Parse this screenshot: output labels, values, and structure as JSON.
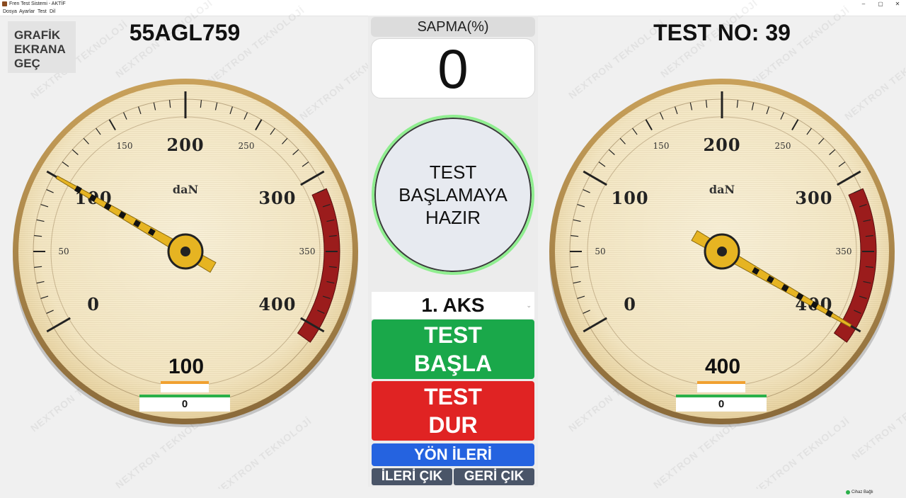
{
  "window": {
    "title": "Fren Test Sistemi - AKTİF",
    "controls": [
      "–",
      "▢",
      "✕"
    ]
  },
  "menu": [
    "Dosya",
    "Ayarlar",
    "Test",
    "Dil"
  ],
  "grafik_button": "GRAFİK\nEKRANA\nGEÇ",
  "plate": "55AGL759",
  "test_no": "TEST NO: 39",
  "sapma": {
    "label": "SAPMA(%)",
    "value": "0"
  },
  "status_text": "TEST\nBAŞLAMAYA\nHAZIR",
  "aks": {
    "selected": "1. AKS"
  },
  "buttons": {
    "start": "TEST\nBAŞLA",
    "stop": "TEST\nDUR",
    "direction": "YÖN İLERİ",
    "forward_exit": "İLERİ ÇIK",
    "back_exit": "GERİ ÇIK"
  },
  "gauges": [
    {
      "name": "left",
      "value": 100,
      "value_text": "100",
      "sub_value": "0"
    },
    {
      "name": "right",
      "value": 400,
      "value_text": "400",
      "sub_value": "0"
    }
  ],
  "gauge_scale": {
    "unit": "daN",
    "min": 0,
    "max": 400,
    "major_labels": [
      "0",
      "100",
      "200",
      "300",
      "400"
    ],
    "minor_labels": [
      "50",
      "150",
      "250",
      "350"
    ],
    "red_zone": [
      310,
      410
    ]
  },
  "watermark": "NEXTRON TEKNOLOJİ",
  "status_bar": {
    "connection": "Cihaz Bağlı"
  },
  "colors": {
    "start": "#1aa84a",
    "stop": "#e02323",
    "direction": "#2563e0",
    "exit": "#4a5568",
    "needle": "#e6b422",
    "red_zone": "#9b1c1c",
    "ready_ring": "#90ee90"
  }
}
